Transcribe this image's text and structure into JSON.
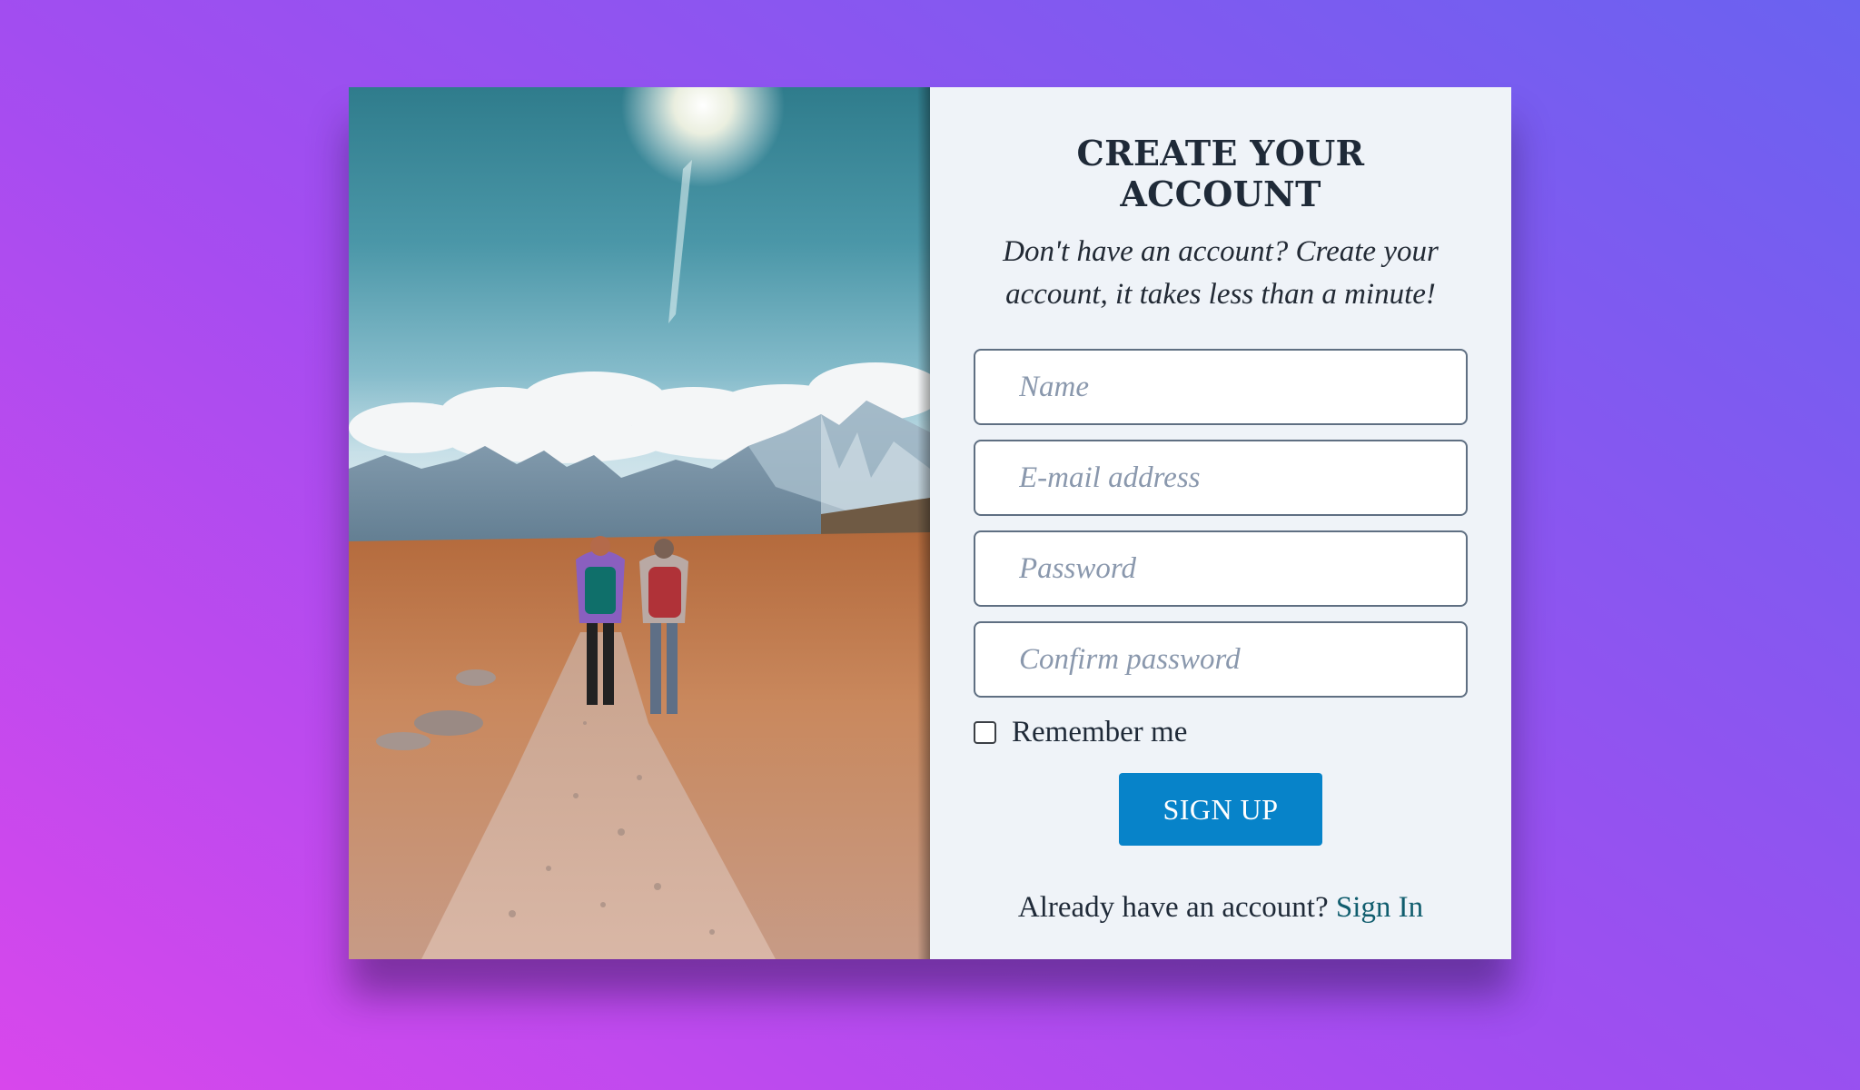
{
  "form": {
    "title": "CREATE YOUR ACCOUNT",
    "subtitle": "Don't have an account? Create your account, it takes less than a minute!",
    "fields": {
      "name": {
        "placeholder": "Name",
        "value": ""
      },
      "email": {
        "placeholder": "E-mail address",
        "value": ""
      },
      "password": {
        "placeholder": "Password",
        "value": ""
      },
      "confirm_password": {
        "placeholder": "Confirm password",
        "value": ""
      }
    },
    "remember": {
      "label": "Remember me",
      "checked": false
    },
    "submit_label": "SIGN UP",
    "signin_prompt": "Already have an account?",
    "signin_link": "Sign In"
  },
  "colors": {
    "background_gradient": [
      "#d847ec",
      "#6a62f0"
    ],
    "panel_bg": "#eff3f8",
    "button_bg": "#0783c9",
    "link": "#105d6e",
    "text": "#1f2a38"
  },
  "image": {
    "subject": "hikers-on-mountain-trail-photo"
  }
}
